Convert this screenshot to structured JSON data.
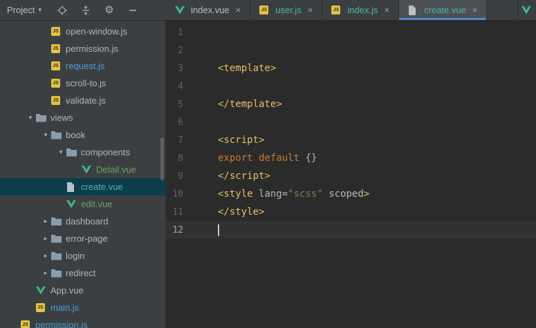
{
  "palette": {
    "default_text": "#A9B7C6",
    "tab_text": "#BBBBBB",
    "modified_blue": "#4A9EDD",
    "added_green": "#69A463",
    "added_teal": "#4DB6AC",
    "tag": "#E8BF6A",
    "keyword": "#CC7832",
    "string": "#6A8759",
    "attr": "#BABABA",
    "plain": "#A9B7C6",
    "line_number": "#606366",
    "active_line_number": "#A4A3A3",
    "selection_bg": "#0E3D4D",
    "current_line_bg": "#323232",
    "tab_underline": "#4A88C7",
    "vue_green": "#41B883",
    "js_yellow": "#E2C443"
  },
  "toolbar": {
    "project_label": "Project",
    "icons": [
      {
        "name": "scope-icon"
      },
      {
        "name": "collapse-all-icon"
      },
      {
        "name": "settings-gear-icon"
      },
      {
        "name": "hide-panel-icon"
      }
    ]
  },
  "tabs": [
    {
      "label": "index.vue",
      "icon": "vue",
      "color": "tab_text"
    },
    {
      "label": "user.js",
      "icon": "js",
      "color": "added_teal"
    },
    {
      "label": "index.js",
      "icon": "js",
      "color": "added_teal"
    },
    {
      "label": "create.vue",
      "icon": "file",
      "color": "added_teal",
      "active": true
    },
    {
      "label": "",
      "icon": "vue",
      "partial": true
    }
  ],
  "tree": {
    "items": [
      {
        "label": "open-window.js",
        "depth": 2,
        "icon": "js"
      },
      {
        "label": "permission.js",
        "depth": 2,
        "icon": "js"
      },
      {
        "label": "request.js",
        "depth": 2,
        "icon": "js",
        "color": "modified_blue"
      },
      {
        "label": "scroll-to.js",
        "depth": 2,
        "icon": "js"
      },
      {
        "label": "validate.js",
        "depth": 2,
        "icon": "js"
      },
      {
        "label": "views",
        "depth": 1,
        "icon": "folder",
        "arrow": "expanded"
      },
      {
        "label": "book",
        "depth": 2,
        "icon": "folder",
        "arrow": "expanded"
      },
      {
        "label": "components",
        "depth": 3,
        "icon": "folder",
        "arrow": "expanded"
      },
      {
        "label": "Detail.vue",
        "depth": 4,
        "icon": "vue",
        "color": "added_green"
      },
      {
        "label": "create.vue",
        "depth": 3,
        "icon": "file",
        "color": "added_teal",
        "selected": true
      },
      {
        "label": "edit.vue",
        "depth": 3,
        "icon": "vue",
        "color": "added_green"
      },
      {
        "label": "dashboard",
        "depth": 2,
        "icon": "folder",
        "arrow": "collapsed"
      },
      {
        "label": "error-page",
        "depth": 2,
        "icon": "folder",
        "arrow": "collapsed"
      },
      {
        "label": "login",
        "depth": 2,
        "icon": "folder",
        "arrow": "collapsed"
      },
      {
        "label": "redirect",
        "depth": 2,
        "icon": "folder",
        "arrow": "collapsed"
      },
      {
        "label": "App.vue",
        "depth": 1,
        "icon": "vue"
      },
      {
        "label": "main.js",
        "depth": 1,
        "icon": "js",
        "color": "modified_blue"
      },
      {
        "label": "permission.js",
        "depth": 0,
        "icon": "js",
        "color": "modified_blue"
      }
    ]
  },
  "editor": {
    "lines": [
      {
        "number": 1,
        "tokens": []
      },
      {
        "number": 2,
        "tokens": []
      },
      {
        "number": 3,
        "tokens": [
          {
            "t": "<template>",
            "c": "tag"
          }
        ]
      },
      {
        "number": 4,
        "tokens": []
      },
      {
        "number": 5,
        "tokens": [
          {
            "t": "</template>",
            "c": "tag"
          }
        ]
      },
      {
        "number": 6,
        "tokens": []
      },
      {
        "number": 7,
        "tokens": [
          {
            "t": "<script>",
            "c": "tag"
          }
        ]
      },
      {
        "number": 8,
        "tokens": [
          {
            "t": "export default",
            "c": "keyword"
          },
          {
            "t": " {}",
            "c": "plain"
          }
        ]
      },
      {
        "number": 9,
        "tokens": [
          {
            "t": "</script>",
            "c": "tag"
          }
        ]
      },
      {
        "number": 10,
        "tokens": [
          {
            "t": "<style ",
            "c": "tag"
          },
          {
            "t": "lang",
            "c": "attr"
          },
          {
            "t": "=",
            "c": "plain"
          },
          {
            "t": "\"scss\"",
            "c": "string"
          },
          {
            "t": " ",
            "c": "plain"
          },
          {
            "t": "scoped",
            "c": "attr"
          },
          {
            "t": ">",
            "c": "tag"
          }
        ]
      },
      {
        "number": 11,
        "tokens": [
          {
            "t": "</style>",
            "c": "tag"
          }
        ]
      },
      {
        "number": 12,
        "tokens": [],
        "active": true
      }
    ]
  }
}
